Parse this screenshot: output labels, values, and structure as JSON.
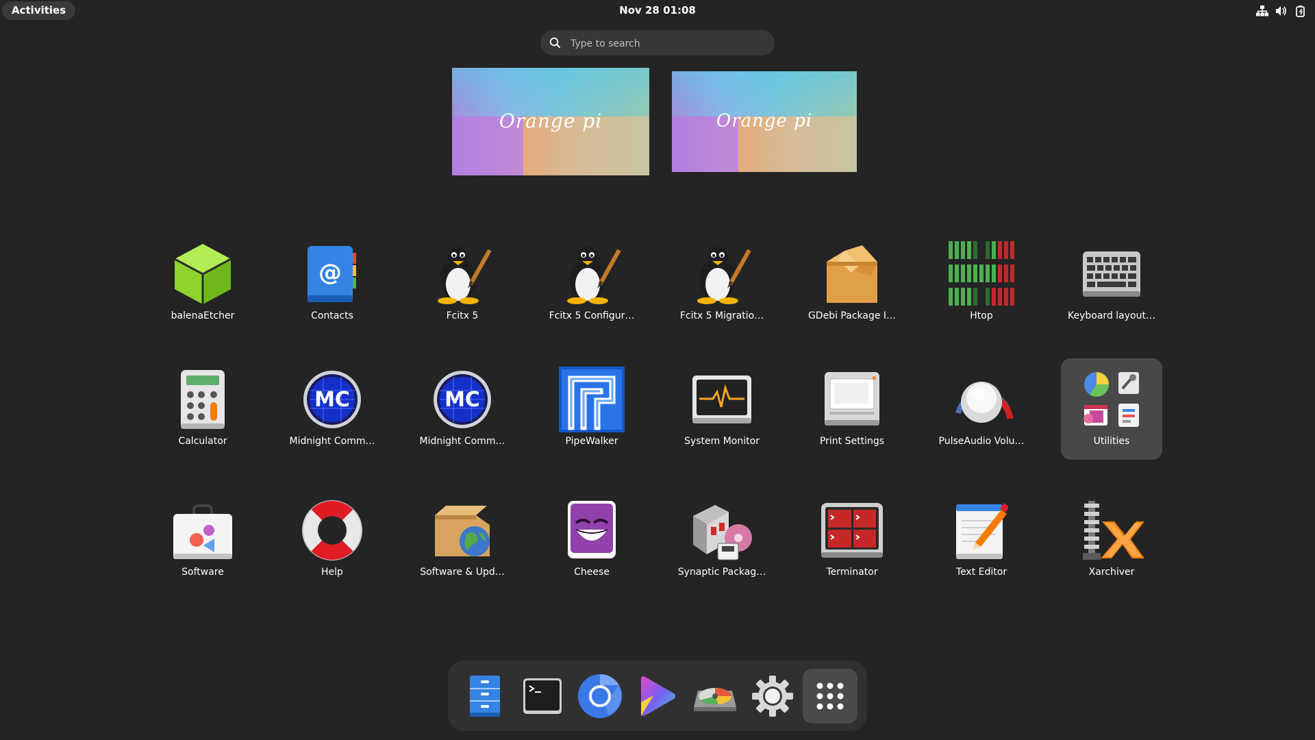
{
  "topbar": {
    "activities_label": "Activities",
    "clock": "Nov 28  01:08",
    "tray_icons": [
      "network-icon",
      "volume-icon",
      "power-icon"
    ]
  },
  "search": {
    "placeholder": "Type to search"
  },
  "workspaces": [
    {
      "brand_text": "Orange pi"
    },
    {
      "brand_text": "Orange pi"
    }
  ],
  "apps": [
    {
      "label": "balenaEtcher",
      "icon": "balena-etcher-icon"
    },
    {
      "label": "Contacts",
      "icon": "contacts-icon"
    },
    {
      "label": "Fcitx 5",
      "icon": "tux-brush-icon"
    },
    {
      "label": "Fcitx 5 Configur…",
      "icon": "tux-brush-icon"
    },
    {
      "label": "Fcitx 5 Migratio…",
      "icon": "tux-brush-icon"
    },
    {
      "label": "GDebi Package I…",
      "icon": "package-box-icon"
    },
    {
      "label": "Htop",
      "icon": "htop-icon"
    },
    {
      "label": "Keyboard layout…",
      "icon": "keyboard-icon"
    },
    {
      "label": "Calculator",
      "icon": "calculator-icon"
    },
    {
      "label": "Midnight Comm…",
      "icon": "midnight-commander-icon"
    },
    {
      "label": "Midnight Comm…",
      "icon": "midnight-commander-icon"
    },
    {
      "label": "PipeWalker",
      "icon": "pipewalker-icon"
    },
    {
      "label": "System Monitor",
      "icon": "system-monitor-icon"
    },
    {
      "label": "Print Settings",
      "icon": "printer-icon"
    },
    {
      "label": "PulseAudio Volu…",
      "icon": "volume-knob-icon"
    },
    {
      "label": "Utilities",
      "icon": "folder-utilities-icon",
      "selected": true
    },
    {
      "label": "Software",
      "icon": "software-bag-icon"
    },
    {
      "label": "Help",
      "icon": "lifebuoy-icon"
    },
    {
      "label": "Software & Upd…",
      "icon": "box-globe-icon"
    },
    {
      "label": "Cheese",
      "icon": "cheese-icon"
    },
    {
      "label": "Synaptic Packag…",
      "icon": "synaptic-icon"
    },
    {
      "label": "Terminator",
      "icon": "terminator-icon"
    },
    {
      "label": "Text Editor",
      "icon": "text-editor-icon"
    },
    {
      "label": "Xarchiver",
      "icon": "xarchiver-icon"
    }
  ],
  "dock": [
    {
      "icon": "files-cabinet-icon"
    },
    {
      "icon": "terminal-icon"
    },
    {
      "icon": "chromium-icon"
    },
    {
      "icon": "video-player-icon"
    },
    {
      "icon": "disk-usage-icon"
    },
    {
      "icon": "settings-gear-icon"
    },
    {
      "icon": "app-grid-icon",
      "active": true
    }
  ],
  "colors": {
    "background": "#242424",
    "topbar_pill": "#3a3a3a",
    "search_bg": "#373737",
    "dock_bg": "#303030",
    "selected_tile": "#484848"
  }
}
